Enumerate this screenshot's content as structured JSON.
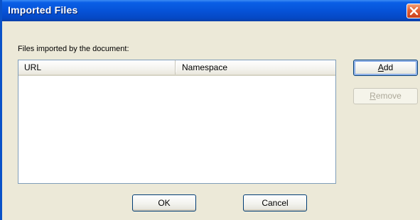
{
  "window": {
    "title": "Imported Files"
  },
  "content": {
    "files_label": "Files imported by the document:",
    "list": {
      "columns": [
        "URL",
        "Namespace"
      ],
      "rows": []
    }
  },
  "buttons": {
    "add": {
      "mnemonic": "A",
      "rest": "dd"
    },
    "remove": {
      "mnemonic": "R",
      "rest": "emove"
    },
    "ok": "OK",
    "cancel": "Cancel"
  },
  "colors": {
    "titlebar": "#0653d8",
    "dialog_bg": "#ece9d8",
    "close_button": "#e45f33",
    "disabled_text": "#aca899"
  },
  "icons": {
    "close": "close-icon"
  }
}
